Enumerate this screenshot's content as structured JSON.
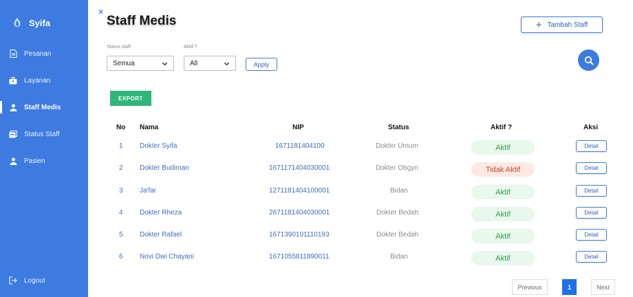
{
  "app": {
    "name": "Syifa"
  },
  "sidebar": {
    "items": [
      {
        "label": "Pesanan",
        "icon": "document-icon",
        "active": false
      },
      {
        "label": "Layanan",
        "icon": "briefcase-icon",
        "active": false
      },
      {
        "label": "Staff Medis",
        "icon": "person-icon",
        "active": true
      },
      {
        "label": "Status Staff",
        "icon": "cards-icon",
        "active": false
      },
      {
        "label": "Pasien",
        "icon": "person-icon",
        "active": false
      }
    ],
    "logout": "Logout"
  },
  "header": {
    "title": "Staff Medis",
    "add_label": "Tambah Staff",
    "close_glyph": "×"
  },
  "filters": {
    "status_label": "Status staff",
    "status_value": "Semua",
    "aktif_label": "Aktif ?",
    "aktif_value": "All",
    "apply_label": "Apply"
  },
  "toolbar": {
    "export_label": "EXPORT"
  },
  "table": {
    "headers": [
      "No",
      "Nama",
      "NIP",
      "Status",
      "Aktif ?",
      "Aksi"
    ],
    "rows": [
      {
        "no": "1",
        "name": "Dokter Syifa",
        "nip": "1671181404100",
        "status": "Dokter Umum",
        "aktif": "Aktif",
        "active": true,
        "action": "Detail"
      },
      {
        "no": "2",
        "name": "Dokter Budiman",
        "nip": "1671171404030001",
        "status": "Dokter Obgyn",
        "aktif": "Tidak Aktif",
        "active": false,
        "action": "Detail"
      },
      {
        "no": "3",
        "name": "Ja'far",
        "nip": "1271181404100001",
        "status": "Bidan",
        "aktif": "Aktif",
        "active": true,
        "action": "Detail"
      },
      {
        "no": "4",
        "name": "Dokter Rheza",
        "nip": "2671181404030001",
        "status": "Dokter Bedah",
        "aktif": "Aktif",
        "active": true,
        "action": "Detail"
      },
      {
        "no": "5",
        "name": "Dokter Rafael",
        "nip": "1671390101110193",
        "status": "Dokter Bedah",
        "aktif": "Aktif",
        "active": true,
        "action": "Detail"
      },
      {
        "no": "6",
        "name": "Novi Dwi Chayani",
        "nip": "1671055811890011",
        "status": "Bidan",
        "aktif": "Aktif",
        "active": true,
        "action": "Detail"
      }
    ]
  },
  "pagination": {
    "previous": "Previous",
    "current": "1",
    "next": "Next"
  },
  "colors": {
    "primary": "#3d7be0",
    "export": "#2fb67a",
    "active_text": "#2f9a4c",
    "inactive_text": "#c9442a"
  }
}
